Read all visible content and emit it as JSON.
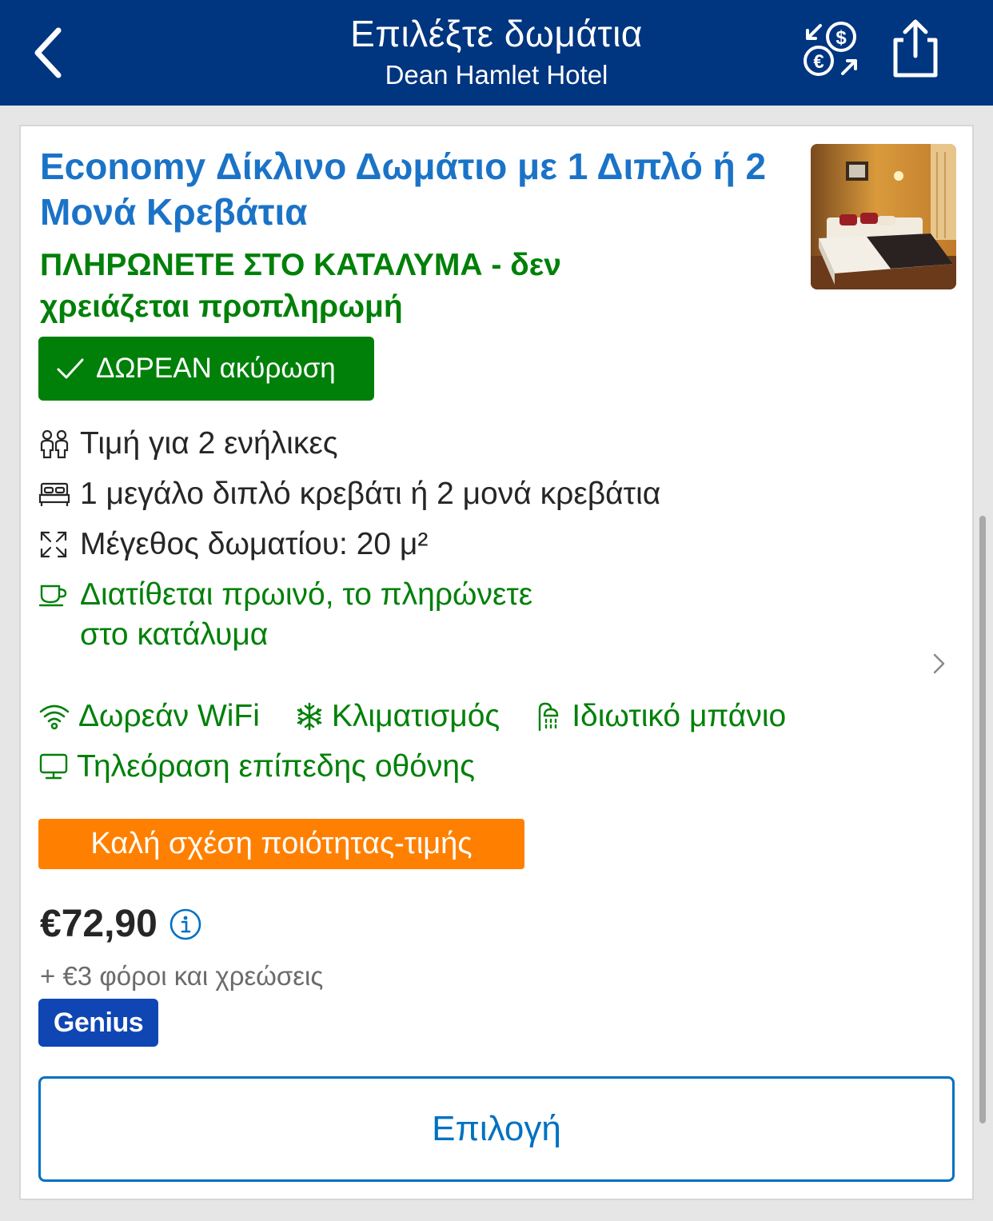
{
  "header": {
    "title": "Επιλέξτε δωμάτια",
    "subtitle": "Dean Hamlet Hotel"
  },
  "room": {
    "title": "Economy Δίκλινο Δωμάτιο με 1 Διπλό ή 2 Μονά Κρεβάτια",
    "payment_note": "ΠΛΗΡΩΝΕΤΕ ΣΤΟ ΚΑΤΑΛΥΜΑ - δεν χρειάζεται προπληρωμή",
    "free_cancellation": "ΔΩΡΕΑΝ ακύρωση",
    "facts": {
      "guests": "Τιμή για 2 ενήλικες",
      "beds": "1 μεγάλο διπλό κρεβάτι ή 2 μονά κρεβάτια",
      "size": "Μέγεθος δωματίου: 20 μ²",
      "breakfast_line1": "Διατίθεται πρωινό, το πληρώνετε",
      "breakfast_line2": "στο κατάλυμα"
    },
    "amenities": {
      "wifi": "Δωρεάν WiFi",
      "ac": "Κλιματισμός",
      "bathroom": "Ιδιωτικό μπάνιο",
      "tv": "Τηλεόραση επίπεδης οθόνης"
    },
    "value_badge": "Καλή σχέση ποιότητας-τιμής",
    "price": "€72,90",
    "taxes": "+ €3 φόροι και χρεώσεις",
    "genius_badge": "Genius",
    "select_button": "Επιλογή"
  },
  "colors": {
    "header_bg": "#003580",
    "title_blue": "#1b73c7",
    "green": "#008009",
    "orange": "#ff8000",
    "button_blue": "#0071c2",
    "genius_blue": "#0f46b3"
  }
}
